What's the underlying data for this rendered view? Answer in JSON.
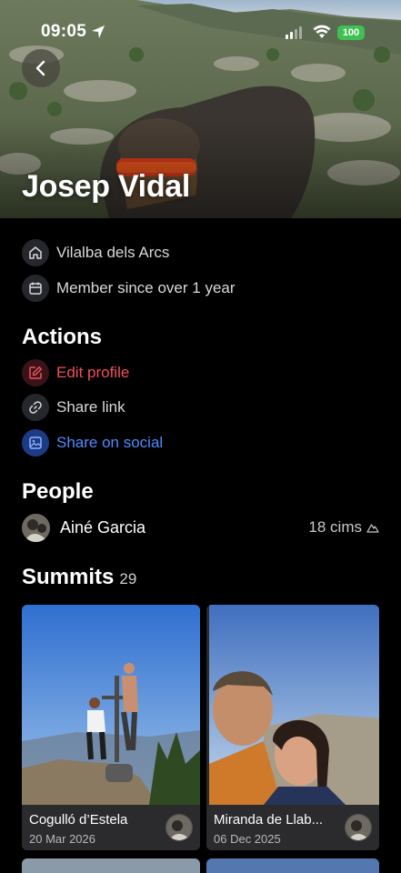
{
  "status_bar": {
    "time": "09:05",
    "battery": "100"
  },
  "profile": {
    "name": "Josep Vidal"
  },
  "info": {
    "location": "Vilalba dels Arcs",
    "member_since": "Member since over 1 year"
  },
  "actions": {
    "title": "Actions",
    "items": [
      {
        "label": "Edit profile",
        "icon": "edit-icon",
        "color": "#ef4f5c"
      },
      {
        "label": "Share link",
        "icon": "link-icon",
        "color": "#d9d9de"
      },
      {
        "label": "Share on social",
        "icon": "image-icon",
        "color": "#4e8bff"
      }
    ]
  },
  "people": {
    "title": "People",
    "items": [
      {
        "name": "Ainé Garcia",
        "cims": "18 cims"
      }
    ]
  },
  "summits": {
    "title": "Summits",
    "count": "29",
    "cards": [
      {
        "title": "Cogulló d’Estela",
        "date": "20 Mar 2026"
      },
      {
        "title": "Miranda de Llab...",
        "date": "06 Dec 2025"
      }
    ]
  },
  "colors": {
    "accent_red": "#ef4f5c",
    "accent_blue": "#4e8bff",
    "battery_green": "#3fc152"
  }
}
